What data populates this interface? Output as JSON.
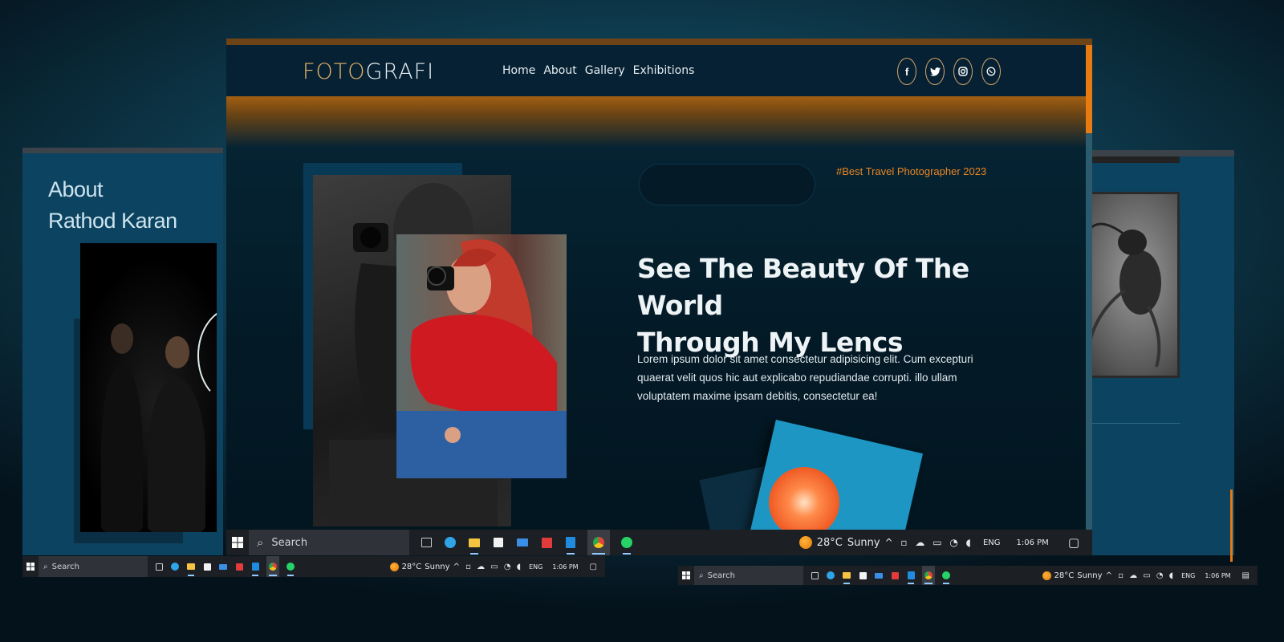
{
  "left_window": {
    "title_line1": "About",
    "title_line2": "Rathod Karan"
  },
  "main_window": {
    "logo_part1": "FOTO",
    "logo_part2": "GRAFI",
    "nav": [
      "Home",
      "About",
      "Gallery",
      "Exhibitions"
    ],
    "social_icons": [
      "facebook-icon",
      "twitter-icon",
      "instagram-icon",
      "whatsapp-icon"
    ],
    "tag": "#Best Travel Photographer 2023",
    "headline_line1": "See The Beauty Of The World",
    "headline_line2": "Through My Lencs",
    "paragraph": "Lorem ipsum dolor sit amet consectetur adipisicing elit. Cum excepturi quaerat velit quos hic aut explicabo repudiandae corrupti. illo ullam voluptatem maxime ipsam debitis, consectetur ea!"
  },
  "taskbar": {
    "search_label": "Search",
    "temperature": "28°C",
    "weather": "Sunny",
    "language": "ENG",
    "time": "1:06 PM"
  },
  "colors": {
    "accent_orange": "#e87a12",
    "tag_orange": "#e88522",
    "window_bg": "#0c4360"
  }
}
